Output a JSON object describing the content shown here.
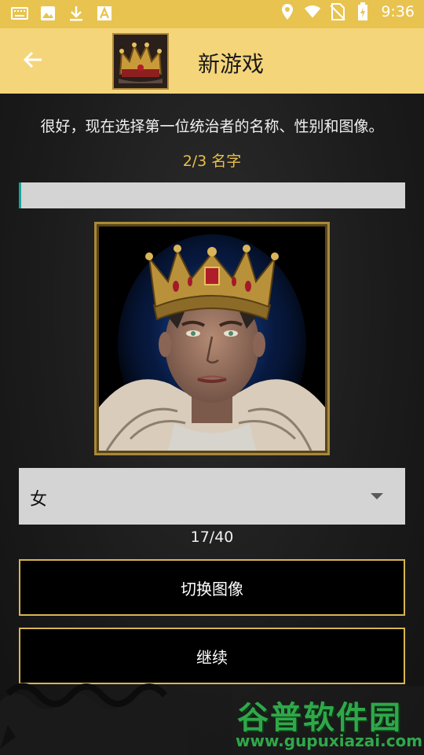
{
  "status_bar": {
    "time": "9:36",
    "icons": [
      "keyboard-icon",
      "image-icon",
      "download-icon",
      "text-a-icon",
      "location-icon",
      "wifi-icon",
      "no-sim-icon",
      "battery-charging-icon"
    ]
  },
  "app_bar": {
    "title": "新游戏",
    "back_icon": "arrow-left-icon",
    "app_icon": "crown-icon"
  },
  "instruction": "很好，现在选择第一位统治者的名称、性别和图像。",
  "step": "2/3 名字",
  "name_input": {
    "value": ""
  },
  "gender_select": {
    "value": "女"
  },
  "counter": "17/40",
  "buttons": {
    "switch_image": "切换图像",
    "continue": "继续"
  },
  "watermark": {
    "logo": "谷普软件园",
    "url": "www.gupuxiazai.com"
  },
  "colors": {
    "status_bar": "#e8c34f",
    "app_bar": "#f5d57a",
    "accent_gold": "#d8b552",
    "step_text": "#e8c04a",
    "input_bg": "#d4d4d4",
    "cursor_teal": "#1aa39a",
    "watermark_green": "#2fa84a"
  }
}
